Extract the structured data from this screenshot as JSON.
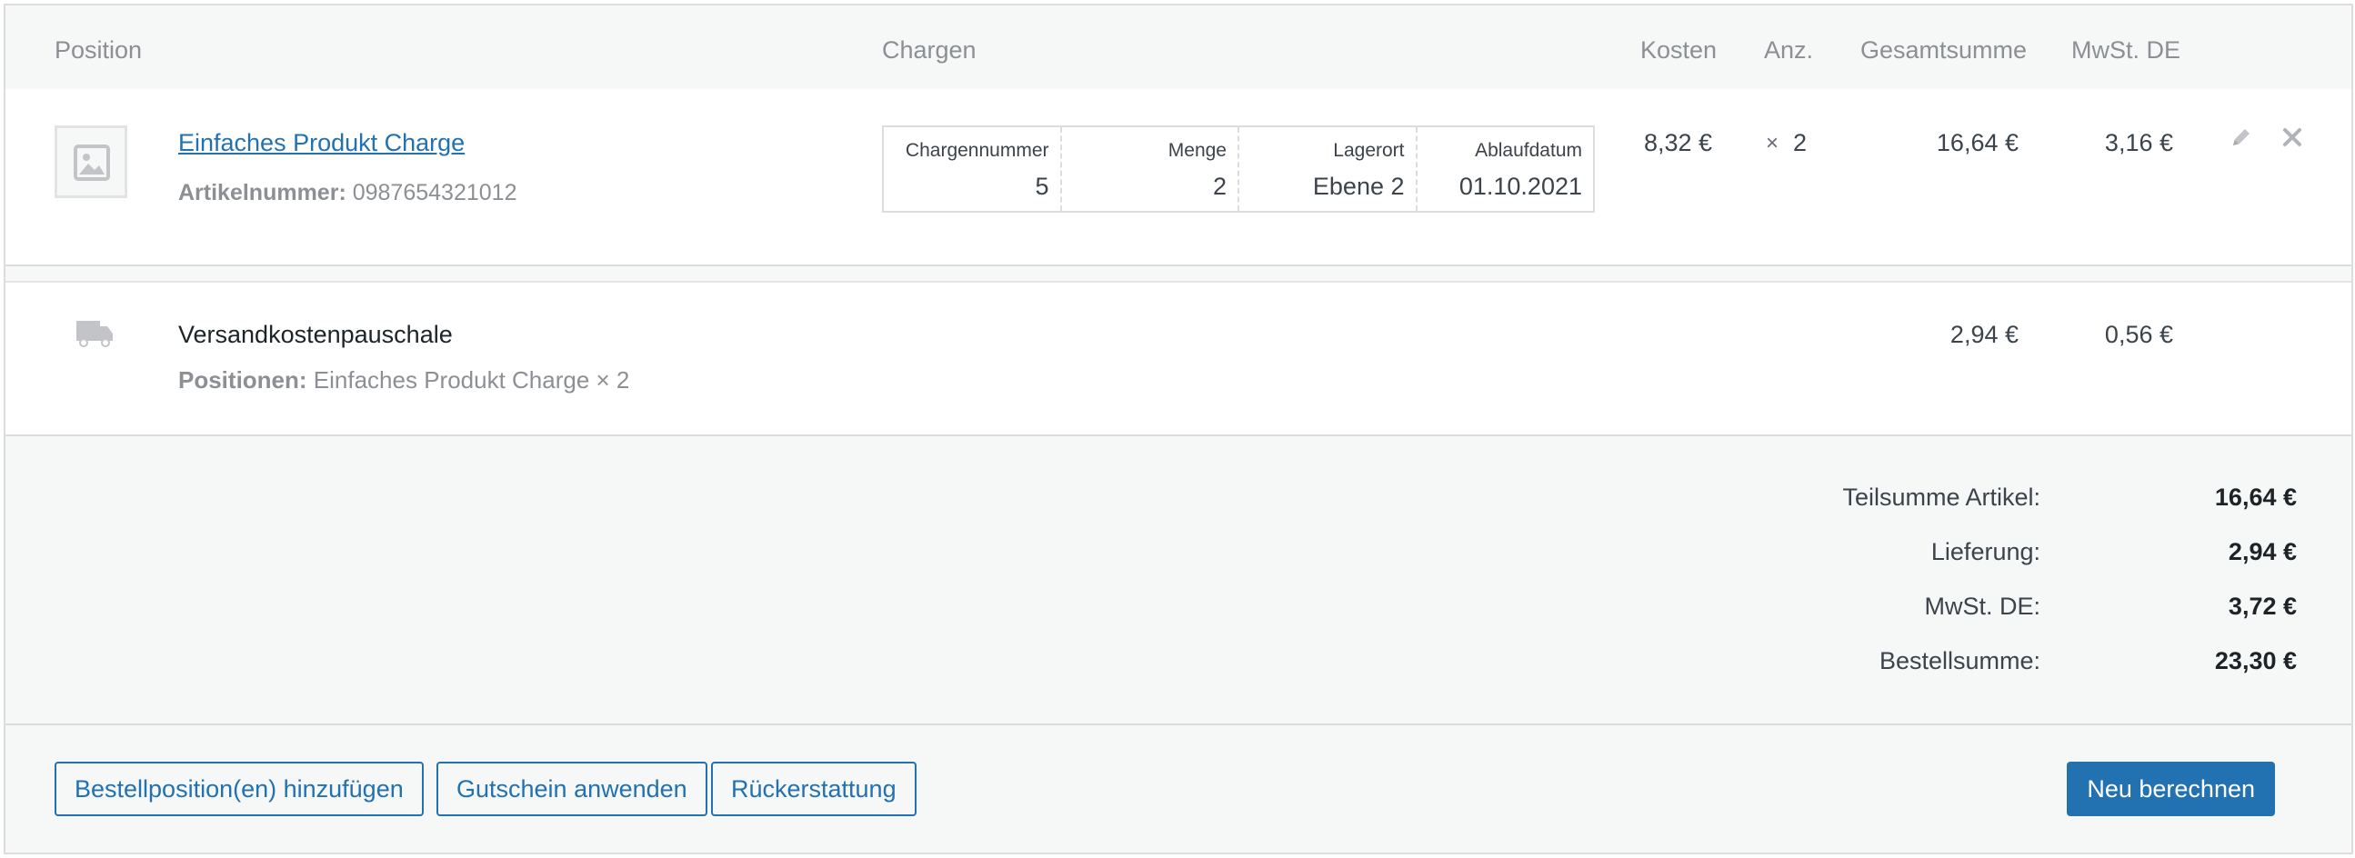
{
  "columns": {
    "position": "Position",
    "chargen": "Chargen",
    "kosten": "Kosten",
    "anzahl": "Anz.",
    "gesamtsumme": "Gesamtsumme",
    "mwst": "MwSt. DE"
  },
  "item": {
    "name": "Einfaches Produkt Charge",
    "sku_label": "Artikelnummer:",
    "sku_value": "0987654321012",
    "batch": {
      "chargennummer_label": "Chargennummer",
      "chargennummer_value": "5",
      "menge_label": "Menge",
      "menge_value": "2",
      "lagerort_label": "Lagerort",
      "lagerort_value": "Ebene 2",
      "ablaufdatum_label": "Ablaufdatum",
      "ablaufdatum_value": "01.10.2021"
    },
    "cost": "8,32 €",
    "qty_prefix": "×",
    "qty": "2",
    "total": "16,64 €",
    "tax": "3,16 €"
  },
  "shipping": {
    "name": "Versandkostenpauschale",
    "items_label": "Positionen:",
    "items_value": "Einfaches Produkt Charge × 2",
    "total": "2,94 €",
    "tax": "0,56 €"
  },
  "totals": [
    {
      "label": "Teilsumme Artikel:",
      "value": "16,64 €"
    },
    {
      "label": "Lieferung:",
      "value": "2,94 €"
    },
    {
      "label": "MwSt. DE:",
      "value": "3,72 €"
    },
    {
      "label": "Bestellsumme:",
      "value": "23,30 €"
    }
  ],
  "buttons": {
    "add_items": "Bestellposition(en) hinzufügen",
    "apply_coupon": "Gutschein anwenden",
    "refund": "Rückerstattung",
    "recalculate": "Neu berechnen"
  },
  "icons": {
    "thumbnail": "image-placeholder-icon",
    "edit": "pencil-icon",
    "delete": "close-icon",
    "shipping": "truck-icon"
  }
}
